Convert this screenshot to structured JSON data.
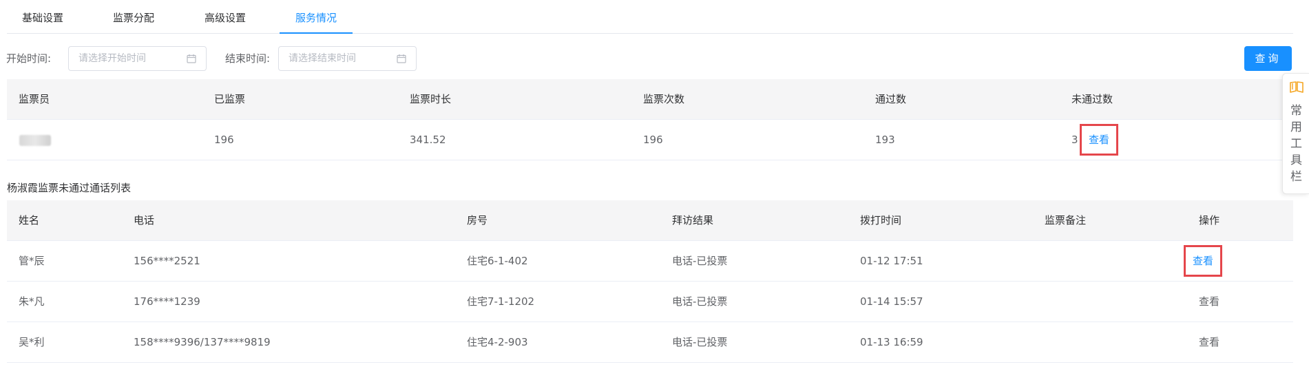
{
  "tabs": [
    {
      "label": "基础设置"
    },
    {
      "label": "监票分配"
    },
    {
      "label": "高级设置"
    },
    {
      "label": "服务情况"
    }
  ],
  "filter": {
    "start_label": "开始时间:",
    "start_placeholder": "请选择开始时间",
    "end_label": "结束时间:",
    "end_placeholder": "请选择结束时间",
    "query_button": "查询"
  },
  "summary_table": {
    "headers": [
      "监票员",
      "已监票",
      "监票时长",
      "监票次数",
      "通过数",
      "未通过数"
    ],
    "row": {
      "inspector": "",
      "done": "196",
      "duration": "341.52",
      "count": "196",
      "passed": "193",
      "failed": "3",
      "view": "查看"
    }
  },
  "section_title": "杨淑霞监票未通过通话列表",
  "calls_table": {
    "headers": [
      "姓名",
      "电话",
      "房号",
      "拜访结果",
      "拨打时间",
      "监票备注",
      "操作"
    ],
    "rows": [
      {
        "name": "管*辰",
        "phone": "156****2521",
        "room": "住宅6-1-402",
        "result": "电话-已投票",
        "time": "01-12 17:51",
        "note": "",
        "action": "查看"
      },
      {
        "name": "朱*凡",
        "phone": "176****1239",
        "room": "住宅7-1-1202",
        "result": "电话-已投票",
        "time": "01-14 15:57",
        "note": "",
        "action": "查看"
      },
      {
        "name": "吴*利",
        "phone": "158****9396/137****9819",
        "room": "住宅4-2-903",
        "result": "电话-已投票",
        "time": "01-13 16:59",
        "note": "",
        "action": "查看"
      }
    ]
  },
  "sidebar": {
    "icon": "book-icon",
    "label": "常用工具栏"
  },
  "colors": {
    "accent": "#1890ff",
    "highlight": "#e5464b",
    "icon_orange": "#f5a623"
  }
}
